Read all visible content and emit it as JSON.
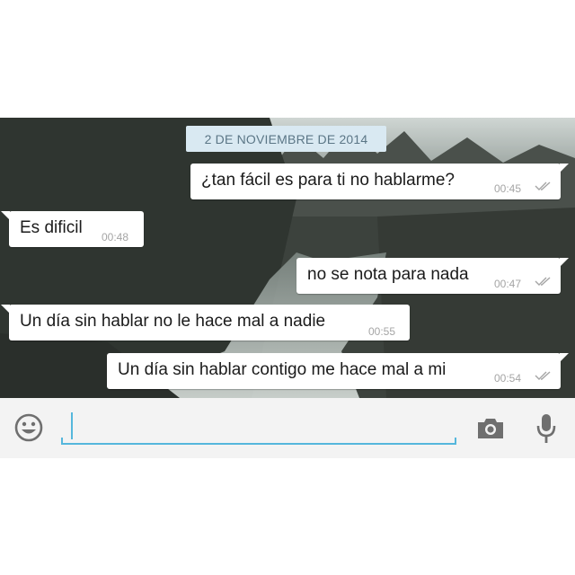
{
  "chat": {
    "date_chip": "2 DE NOVIEMBRE DE 2014",
    "messages": [
      {
        "direction": "outgoing",
        "text": "¿tan fácil es para ti no hablarme?",
        "time": "00:45",
        "status": "read-double-check"
      },
      {
        "direction": "incoming",
        "text": "Es dificil",
        "time": "00:48"
      },
      {
        "direction": "outgoing",
        "text": "no se nota para nada",
        "time": "00:47",
        "status": "read-double-check"
      },
      {
        "direction": "incoming",
        "text": "Un día sin hablar no le hace mal a nadie",
        "time": "00:55"
      },
      {
        "direction": "outgoing",
        "text": "Un día sin hablar contigo me hace mal a mi",
        "time": "00:54",
        "status": "read-double-check"
      }
    ]
  },
  "composer": {
    "emoji_icon": "smiley-face-icon",
    "message_value": "",
    "placeholder": "",
    "camera_icon": "camera-icon",
    "mic_icon": "microphone-icon",
    "accent_color": "#55b7dc"
  }
}
